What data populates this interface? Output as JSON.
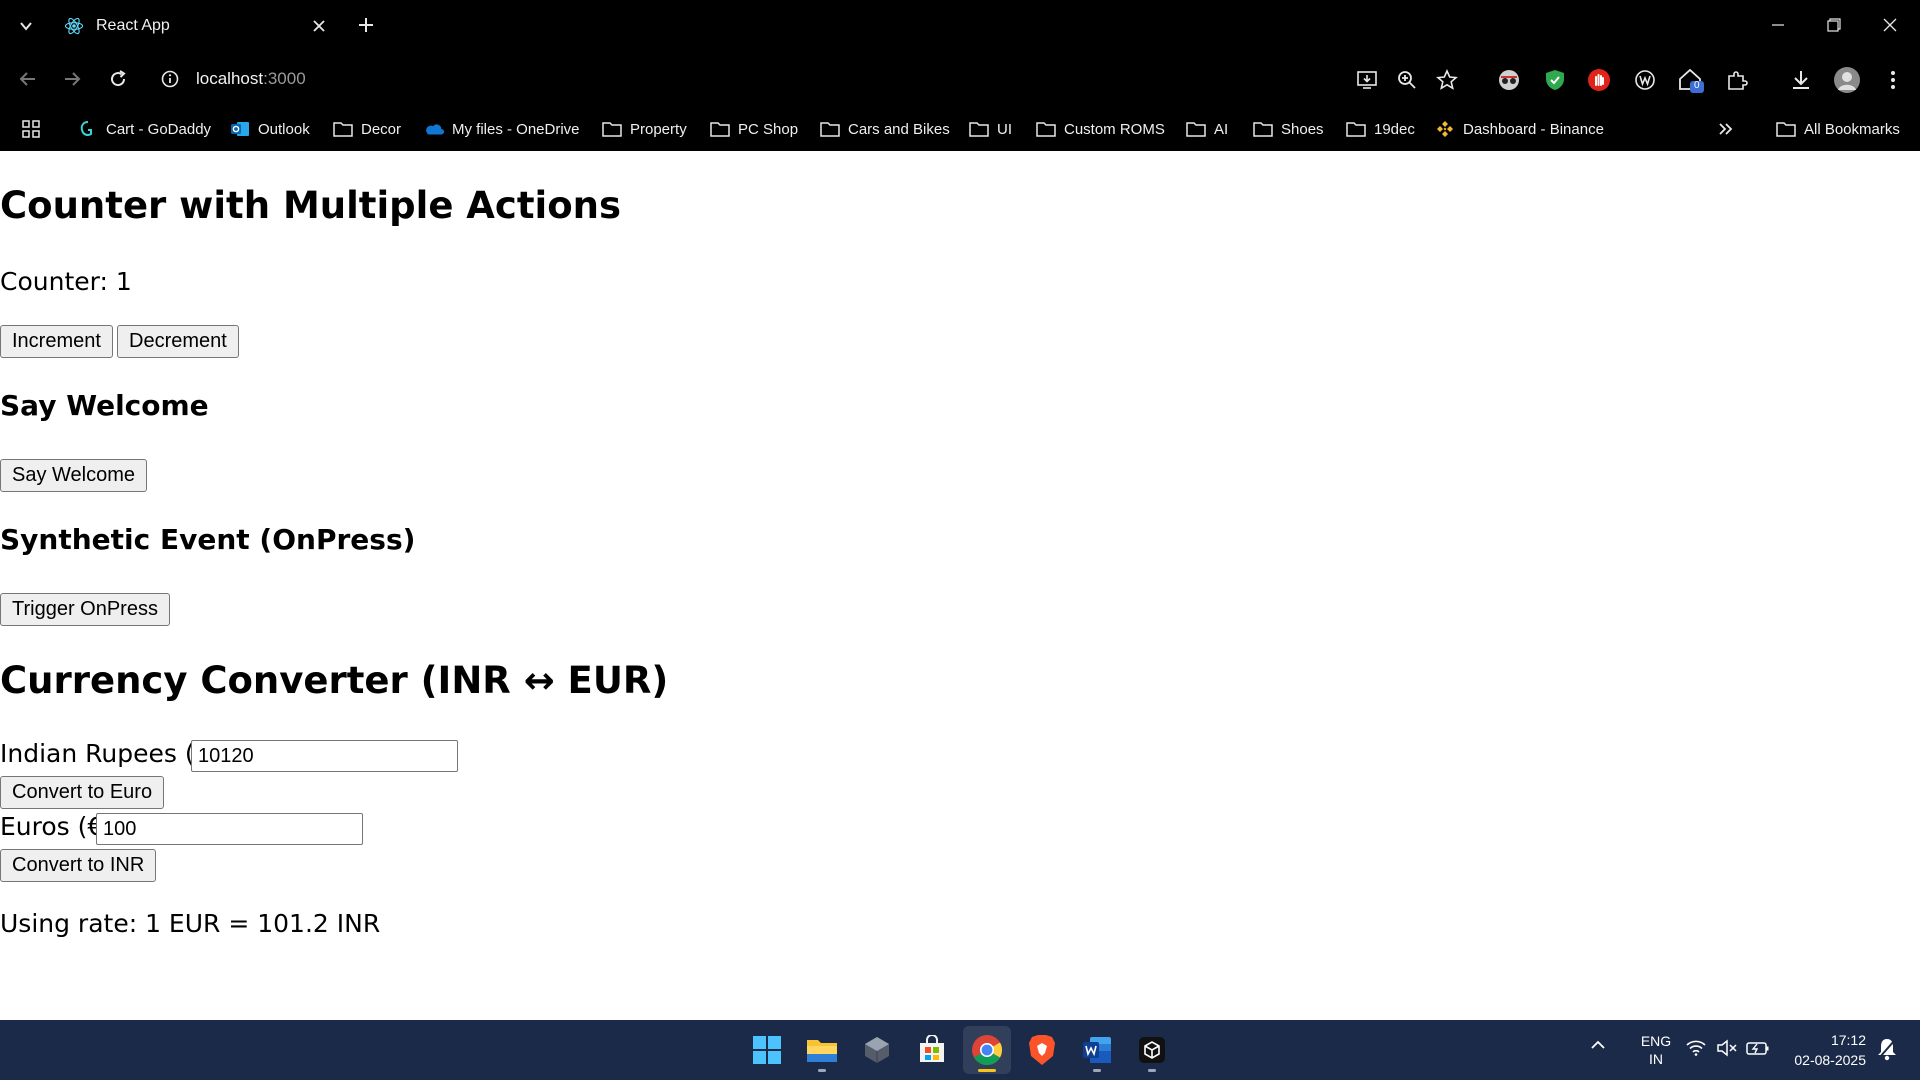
{
  "browser": {
    "tab_title": "React App",
    "url_host": "localhost",
    "url_port": ":3000",
    "extension_badge": "0"
  },
  "bookmarks": [
    {
      "label": "Cart - GoDaddy",
      "icon": "godaddy-icon"
    },
    {
      "label": "Outlook",
      "icon": "outlook-icon"
    },
    {
      "label": "Decor",
      "icon": "folder-icon"
    },
    {
      "label": "My files - OneDrive",
      "icon": "onedrive-icon"
    },
    {
      "label": "Property",
      "icon": "folder-icon"
    },
    {
      "label": "PC Shop",
      "icon": "folder-icon"
    },
    {
      "label": "Cars and Bikes",
      "icon": "folder-icon"
    },
    {
      "label": "UI",
      "icon": "folder-icon"
    },
    {
      "label": "Custom ROMS",
      "icon": "folder-icon"
    },
    {
      "label": "AI",
      "icon": "folder-icon"
    },
    {
      "label": "Shoes",
      "icon": "folder-icon"
    },
    {
      "label": "19dec",
      "icon": "folder-icon"
    },
    {
      "label": "Dashboard - Binance",
      "icon": "binance-icon"
    }
  ],
  "all_bookmarks_label": "All Bookmarks",
  "page": {
    "counter_heading": "Counter with Multiple Actions",
    "counter_text": "Counter: 1",
    "increment_label": "Increment",
    "decrement_label": "Decrement",
    "welcome_heading": "Say Welcome",
    "welcome_button": "Say Welcome",
    "synthetic_heading": "Synthetic Event (OnPress)",
    "synthetic_button": "Trigger OnPress",
    "currency_heading": "Currency Converter (INR ↔ EUR)",
    "inr_label": "Indian Rupees (₹)",
    "inr_value": "10120",
    "to_euro_button": "Convert to Euro",
    "eur_label": "Euros (€)",
    "eur_value": "100",
    "to_inr_button": "Convert to INR",
    "rate_text": "Using rate: 1 EUR = 101.2 INR"
  },
  "taskbar": {
    "lang_top": "ENG",
    "lang_bottom": "IN",
    "time": "17:12",
    "date": "02-08-2025"
  },
  "colors": {
    "chrome_bg": "#000000",
    "taskbar_bg": "#1b2a48",
    "active_indicator": "#f5c518"
  }
}
